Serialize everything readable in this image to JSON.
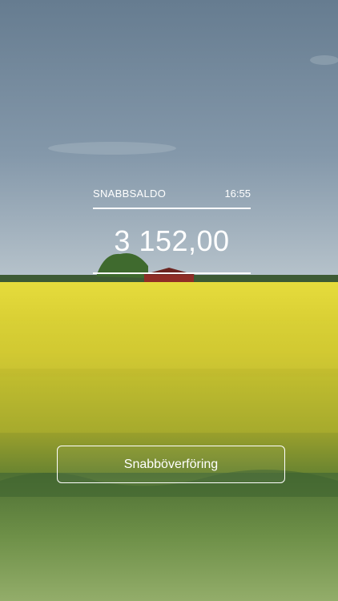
{
  "balance": {
    "label": "SNABBSALDO",
    "time": "16:55",
    "amount": "3 152,00"
  },
  "actions": {
    "transfer_label": "Snabböverföring"
  },
  "colors": {
    "text": "#ffffff",
    "sky": "#7b8fa3",
    "field": "#d8d23a",
    "grass": "#4f7a3a"
  }
}
